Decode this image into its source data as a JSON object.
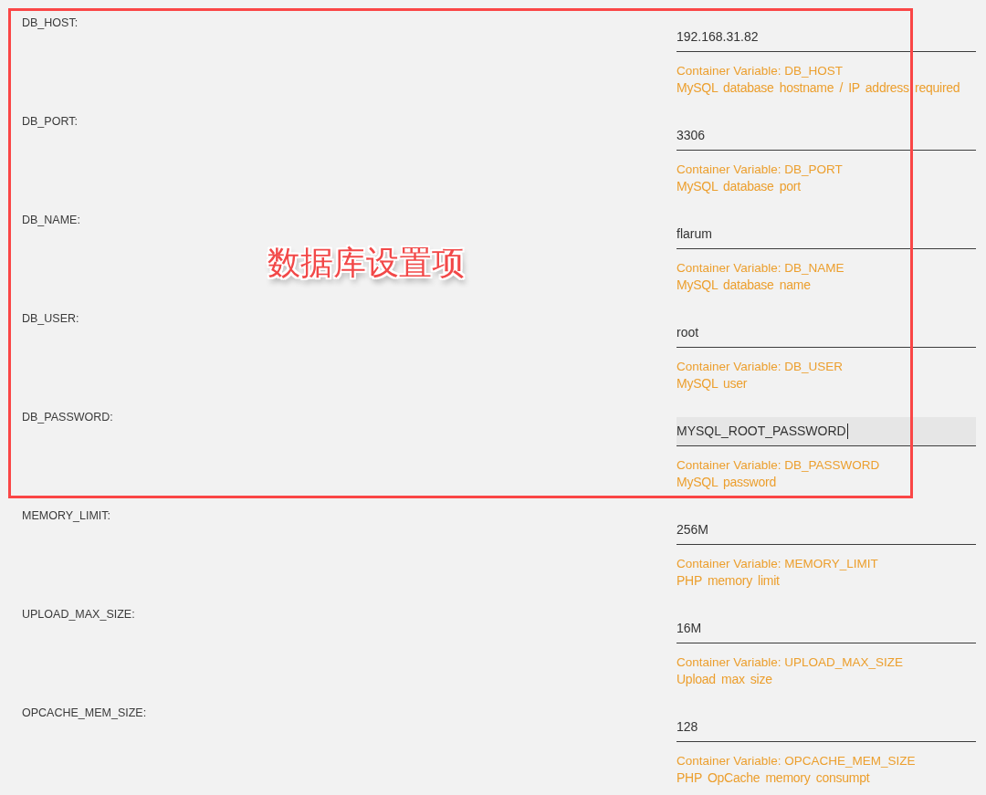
{
  "fields": [
    {
      "label": "DB_HOST:",
      "value": "192.168.31.82",
      "focused": false,
      "variable": "Container Variable: DB_HOST",
      "description": "MySQL database hostname / IP address required"
    },
    {
      "label": "DB_PORT:",
      "value": "3306",
      "focused": false,
      "variable": "Container Variable: DB_PORT",
      "description": "MySQL database port"
    },
    {
      "label": "DB_NAME:",
      "value": "flarum",
      "focused": false,
      "variable": "Container Variable: DB_NAME",
      "description": "MySQL database name"
    },
    {
      "label": "DB_USER:",
      "value": "root",
      "focused": false,
      "variable": "Container Variable: DB_USER",
      "description": "MySQL user"
    },
    {
      "label": "DB_PASSWORD:",
      "value": "MYSQL_ROOT_PASSWORD",
      "focused": true,
      "variable": "Container Variable: DB_PASSWORD",
      "description": "MySQL password"
    },
    {
      "label": "MEMORY_LIMIT:",
      "value": "256M",
      "focused": false,
      "variable": "Container Variable: MEMORY_LIMIT",
      "description": "PHP memory limit"
    },
    {
      "label": "UPLOAD_MAX_SIZE:",
      "value": "16M",
      "focused": false,
      "variable": "Container Variable: UPLOAD_MAX_SIZE",
      "description": "Upload max size"
    },
    {
      "label": "OPCACHE_MEM_SIZE:",
      "value": "128",
      "focused": false,
      "variable": "Container Variable: OPCACHE_MEM_SIZE",
      "description": "PHP OpCache memory consumpt"
    }
  ],
  "annotation": {
    "text": "数据库设置项"
  }
}
